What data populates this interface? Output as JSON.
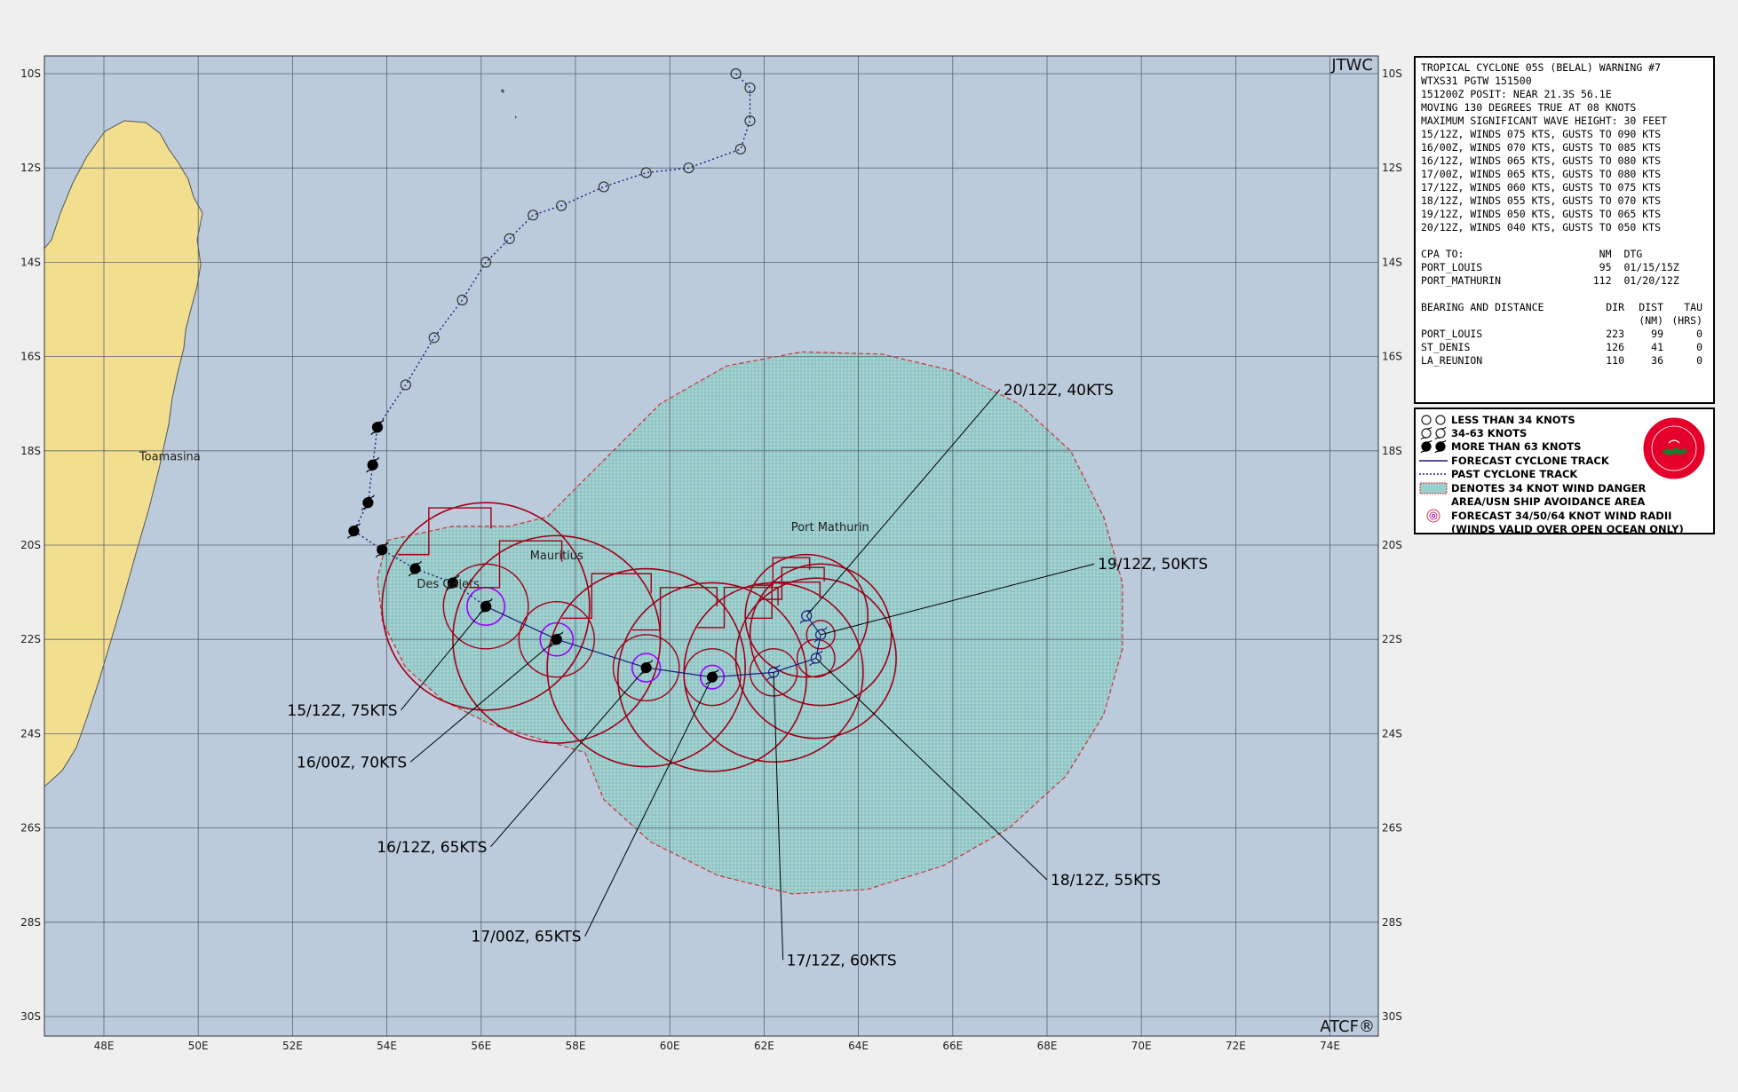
{
  "header": {
    "agency": "JTWC",
    "atcf": "ATCF®"
  },
  "axes": {
    "lat_labels": [
      "10S",
      "12S",
      "14S",
      "16S",
      "18S",
      "20S",
      "22S",
      "24S",
      "26S",
      "28S",
      "30S"
    ],
    "lon_labels": [
      "48E",
      "50E",
      "52E",
      "54E",
      "56E",
      "58E",
      "60E",
      "62E",
      "64E",
      "66E",
      "68E",
      "70E",
      "72E",
      "74E"
    ]
  },
  "places": [
    {
      "name": "Toamasina",
      "lon": 49.4,
      "lat": -18.2
    },
    {
      "name": "Port Mathurin",
      "lon": 63.4,
      "lat": -19.7
    },
    {
      "name": "Mauritius",
      "lon": 57.6,
      "lat": -20.3
    },
    {
      "name": "Des Galets",
      "lon": 55.3,
      "lat": -20.9
    }
  ],
  "past_track": {
    "points": [
      {
        "lon": 61.4,
        "lat": -10.0,
        "class": "lt34"
      },
      {
        "lon": 61.7,
        "lat": -10.3,
        "class": "lt34"
      },
      {
        "lon": 61.7,
        "lat": -11.0,
        "class": "lt34"
      },
      {
        "lon": 61.5,
        "lat": -11.6,
        "class": "lt34"
      },
      {
        "lon": 60.4,
        "lat": -12.0,
        "class": "lt34"
      },
      {
        "lon": 59.5,
        "lat": -12.1,
        "class": "lt34"
      },
      {
        "lon": 58.6,
        "lat": -12.4,
        "class": "lt34"
      },
      {
        "lon": 57.7,
        "lat": -12.8,
        "class": "lt34"
      },
      {
        "lon": 57.1,
        "lat": -13.0,
        "class": "lt34"
      },
      {
        "lon": 56.6,
        "lat": -13.5,
        "class": "lt34"
      },
      {
        "lon": 56.1,
        "lat": -14.0,
        "class": "lt34"
      },
      {
        "lon": 55.6,
        "lat": -14.8,
        "class": "lt34"
      },
      {
        "lon": 55.0,
        "lat": -15.6,
        "class": "lt34"
      },
      {
        "lon": 54.4,
        "lat": -16.6,
        "class": "lt34"
      },
      {
        "lon": 53.8,
        "lat": -17.5,
        "class": "gt63"
      },
      {
        "lon": 53.7,
        "lat": -18.3,
        "class": "gt63"
      },
      {
        "lon": 53.6,
        "lat": -19.1,
        "class": "gt63"
      },
      {
        "lon": 53.3,
        "lat": -19.7,
        "class": "gt63"
      },
      {
        "lon": 53.9,
        "lat": -20.1,
        "class": "gt63"
      },
      {
        "lon": 54.6,
        "lat": -20.5,
        "class": "gt63"
      },
      {
        "lon": 55.4,
        "lat": -20.8,
        "class": "gt63"
      },
      {
        "lon": 56.1,
        "lat": -21.3,
        "class": "gt63"
      }
    ]
  },
  "forecast_track": {
    "points": [
      {
        "label": "15/12Z, 75KTS",
        "lon": 56.1,
        "lat": -21.3,
        "class": "gt63",
        "label_lon": 54.3,
        "label_lat": -23.5
      },
      {
        "label": "16/00Z, 70KTS",
        "lon": 57.6,
        "lat": -22.0,
        "class": "gt63",
        "label_lon": 54.5,
        "label_lat": -24.6
      },
      {
        "label": "16/12Z, 65KTS",
        "lon": 59.5,
        "lat": -22.6,
        "class": "gt63",
        "label_lon": 56.2,
        "label_lat": -26.4
      },
      {
        "label": "17/00Z, 65KTS",
        "lon": 60.9,
        "lat": -22.8,
        "class": "gt63",
        "label_lon": 58.2,
        "label_lat": -28.3
      },
      {
        "label": "17/12Z, 60KTS",
        "lon": 62.2,
        "lat": -22.7,
        "class": "34to63",
        "label_lon": 62.4,
        "label_lat": -28.8
      },
      {
        "label": "18/12Z, 55KTS",
        "lon": 63.1,
        "lat": -22.4,
        "class": "34to63",
        "label_lon": 68.0,
        "label_lat": -27.1
      },
      {
        "label": "19/12Z, 50KTS",
        "lon": 63.2,
        "lat": -21.9,
        "class": "34to63",
        "label_lon": 69.0,
        "label_lat": -20.4
      },
      {
        "label": "20/12Z, 40KTS",
        "lon": 62.9,
        "lat": -21.5,
        "class": "34to63",
        "label_lon": 67.0,
        "label_lat": -16.7
      }
    ]
  },
  "warning": {
    "title": "TROPICAL CYCLONE 05S (BELAL) WARNING #7",
    "header": "WTXS31 PGTW 151500",
    "posit": "151200Z POSIT: NEAR 21.3S 56.1E",
    "moving": "MOVING 130 DEGREES TRUE AT 08 KNOTS",
    "wave": "MAXIMUM SIGNIFICANT WAVE HEIGHT: 30 FEET",
    "forecasts": [
      "15/12Z, WINDS 075 KTS, GUSTS TO 090 KTS",
      "16/00Z, WINDS 070 KTS, GUSTS TO 085 KTS",
      "16/12Z, WINDS 065 KTS, GUSTS TO 080 KTS",
      "17/00Z, WINDS 065 KTS, GUSTS TO 080 KTS",
      "17/12Z, WINDS 060 KTS, GUSTS TO 075 KTS",
      "18/12Z, WINDS 055 KTS, GUSTS TO 070 KTS",
      "19/12Z, WINDS 050 KTS, GUSTS TO 065 KTS",
      "20/12Z, WINDS 040 KTS, GUSTS TO 050 KTS"
    ],
    "cpa": {
      "header": [
        "CPA TO:",
        "NM",
        "DTG"
      ],
      "rows": [
        [
          "PORT_LOUIS",
          "95",
          "01/15/15Z"
        ],
        [
          "PORT_MATHURIN",
          "112",
          "01/20/12Z"
        ]
      ]
    },
    "bearing": {
      "header": [
        "BEARING AND DISTANCE",
        "DIR",
        "DIST",
        "TAU"
      ],
      "subheader": [
        "",
        "",
        "(NM)",
        "(HRS)"
      ],
      "rows": [
        [
          "PORT_LOUIS",
          "223",
          "99",
          "0"
        ],
        [
          "ST_DENIS",
          "126",
          "41",
          "0"
        ],
        [
          "LA_REUNION",
          "110",
          "36",
          "0"
        ]
      ]
    }
  },
  "legend": {
    "items": [
      {
        "symbol": "lt34",
        "text": "LESS THAN 34 KNOTS"
      },
      {
        "symbol": "34to63",
        "text": "34-63 KNOTS"
      },
      {
        "symbol": "gt63",
        "text": "MORE THAN 63 KNOTS"
      },
      {
        "symbol": "forecast-line",
        "text": "FORECAST CYCLONE TRACK"
      },
      {
        "symbol": "past-line",
        "text": "PAST CYCLONE TRACK"
      },
      {
        "symbol": "danger-area",
        "text": "DENOTES 34 KNOT WIND DANGER"
      },
      {
        "symbol": "",
        "text": "AREA/USN SHIP AVOIDANCE AREA"
      },
      {
        "symbol": "wind-radii",
        "text": "FORECAST 34/50/64 KNOT WIND RADII"
      },
      {
        "symbol": "",
        "text": "(WINDS VALID OVER OPEN OCEAN ONLY)"
      }
    ]
  },
  "colors": {
    "ocean": "#bccbdc",
    "land": "#f2de8f",
    "grid": "#5b6472",
    "danger_fill": "#9ccfcf",
    "danger_border": "#cc3333",
    "radii_34": "#a00018",
    "radii_64": "#9b00ff",
    "forecast_track": "#1a1a7a",
    "past_track": "#1a1a7a"
  }
}
